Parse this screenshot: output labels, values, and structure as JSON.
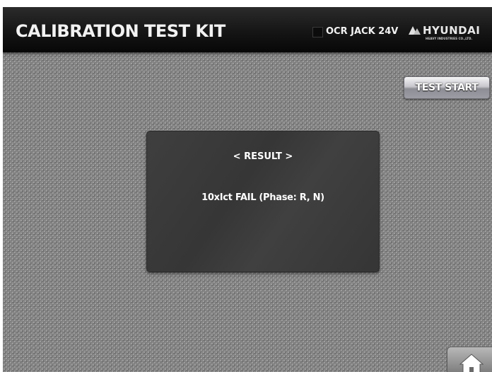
{
  "header": {
    "title": "CALIBRATION TEST KIT",
    "device_label": "OCR JACK 24V",
    "brand": {
      "name": "HYUNDAI",
      "subtitle": "HEAVY INDUSTRIES CO.,LTD."
    }
  },
  "toolbar": {
    "test_start_label": "TEST START"
  },
  "result": {
    "heading": "< RESULT >",
    "message": "10xIct FAIL (Phase: R, N)"
  },
  "icons": {
    "home": "home-icon",
    "brand_mark": "triangle-logo-icon"
  },
  "colors": {
    "header_bg": "#151515",
    "screen_bg": "#8b8b8b",
    "panel_bg": "#3a3a3a",
    "text": "#ffffff"
  }
}
